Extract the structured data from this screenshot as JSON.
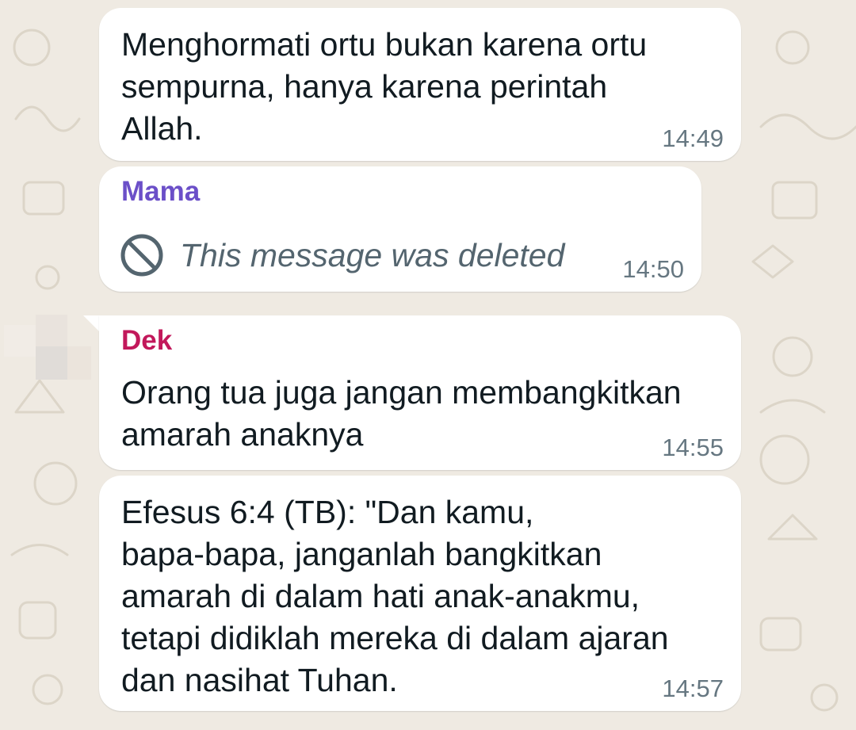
{
  "messages": [
    {
      "text": "Menghormati ortu bukan karena ortu\nsempurna, hanya karena perintah\nAllah.",
      "time": "14:49"
    },
    {
      "sender": "Mama",
      "sender_color": "#6b4fc8",
      "deleted_text": "This message was deleted",
      "deleted_icon": "blocked-icon",
      "time": "14:50"
    },
    {
      "sender": "Dek",
      "sender_color": "#c2185b",
      "text": "Orang tua juga jangan membangkitkan\namarah anaknya",
      "time": "14:55"
    },
    {
      "text": "Efesus 6:4 (TB): \"Dan kamu,\nbapa-bapa, janganlah bangkitkan\namarah di dalam hati anak-anakmu,\ntetapi didiklah mereka di dalam ajaran\ndan nasihat Tuhan.",
      "time": "14:57"
    }
  ],
  "colors": {
    "chat_background": "#efeae2",
    "bubble": "#ffffff",
    "timestamp": "#667781"
  }
}
